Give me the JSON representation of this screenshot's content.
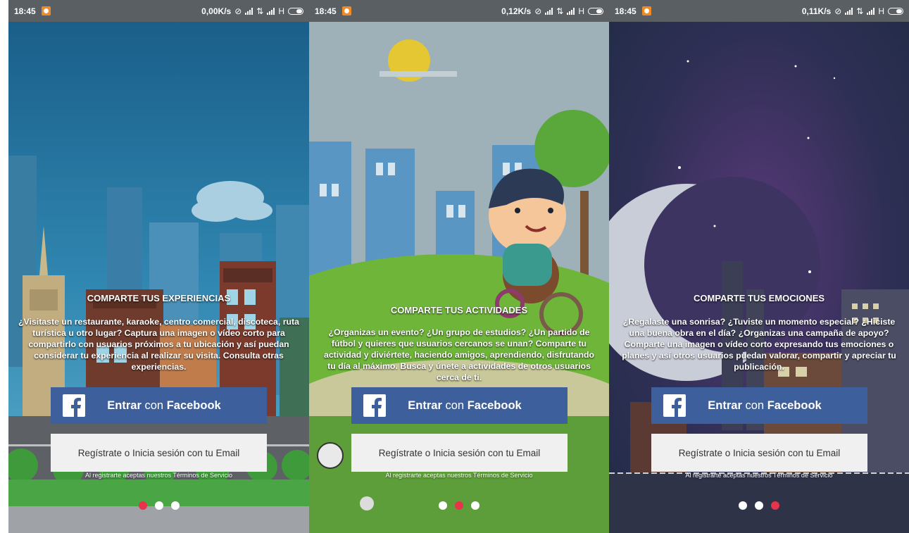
{
  "status_bars": [
    {
      "time": "18:45",
      "speed": "0,00K/s",
      "network": "H"
    },
    {
      "time": "18:45",
      "speed": "0,12K/s",
      "network": "H"
    },
    {
      "time": "18:45",
      "speed": "0,11K/s",
      "network": "H"
    }
  ],
  "screens": [
    {
      "title": "COMPARTE TUS EXPERIENCIAS",
      "body": "¿Visitaste un restaurante, karaoke, centro comercial, discoteca, ruta turística u otro lugar? Captura una imagen o vídeo corto para compartirlo con usuarios próximos a tu ubicación y así puedan considerar tu experiencia al realizar su visita. Consulta otras experiencias.",
      "active_dot": 0
    },
    {
      "title": "COMPARTE TUS ACTIVIDADES",
      "body": "¿Organizas un evento? ¿Un grupo de estudios? ¿Un partido de fútbol y quieres que usuarios cercanos se unan? Comparte tu actividad y diviértete, haciendo amigos, aprendiendo, disfrutando tu día al máximo. Busca y únete a actividades de otros usuarios cerca de ti.",
      "active_dot": 1
    },
    {
      "title": "COMPARTE TUS EMOCIONES",
      "body": "¿Regalaste una sonrisa? ¿Tuviste un momento especial? ¿Hiciste una buena obra en el día? ¿Organizas una campaña de apoyo? Comparte una imagen o vídeo corto expresando tus emociones o planes y así otros usuarios puedan valorar, compartir y apreciar tu publicación.",
      "active_dot": 2
    }
  ],
  "facebook_button": {
    "prefix": "Entrar",
    "middle": "con",
    "brand": "Facebook",
    "icon": "facebook-f-icon"
  },
  "email_button": {
    "label": "Regístrate o Inicia sesión con tu Email"
  },
  "terms": {
    "text": "Al registrarte aceptas nuestros Términos de Servicio"
  },
  "colors": {
    "facebook_blue": "#3d5f9c",
    "email_bg": "#f0f0f0",
    "dot_active": "#e8334a",
    "dot_inactive": "#ffffff"
  }
}
